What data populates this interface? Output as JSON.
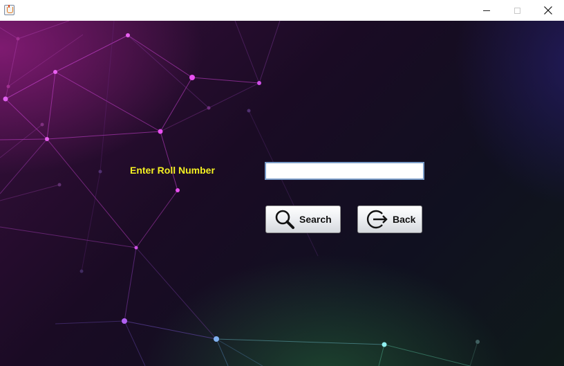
{
  "window": {
    "icon": "java-cup-icon",
    "controls": [
      "minimize-icon",
      "maximize-icon",
      "close-icon"
    ]
  },
  "form": {
    "roll_label": "Enter Roll Number",
    "roll_value": "",
    "search_label": "Search",
    "search_icon": "search-icon",
    "back_label": "Back",
    "back_icon": "exit-icon",
    "label_color": "#f4f022"
  }
}
